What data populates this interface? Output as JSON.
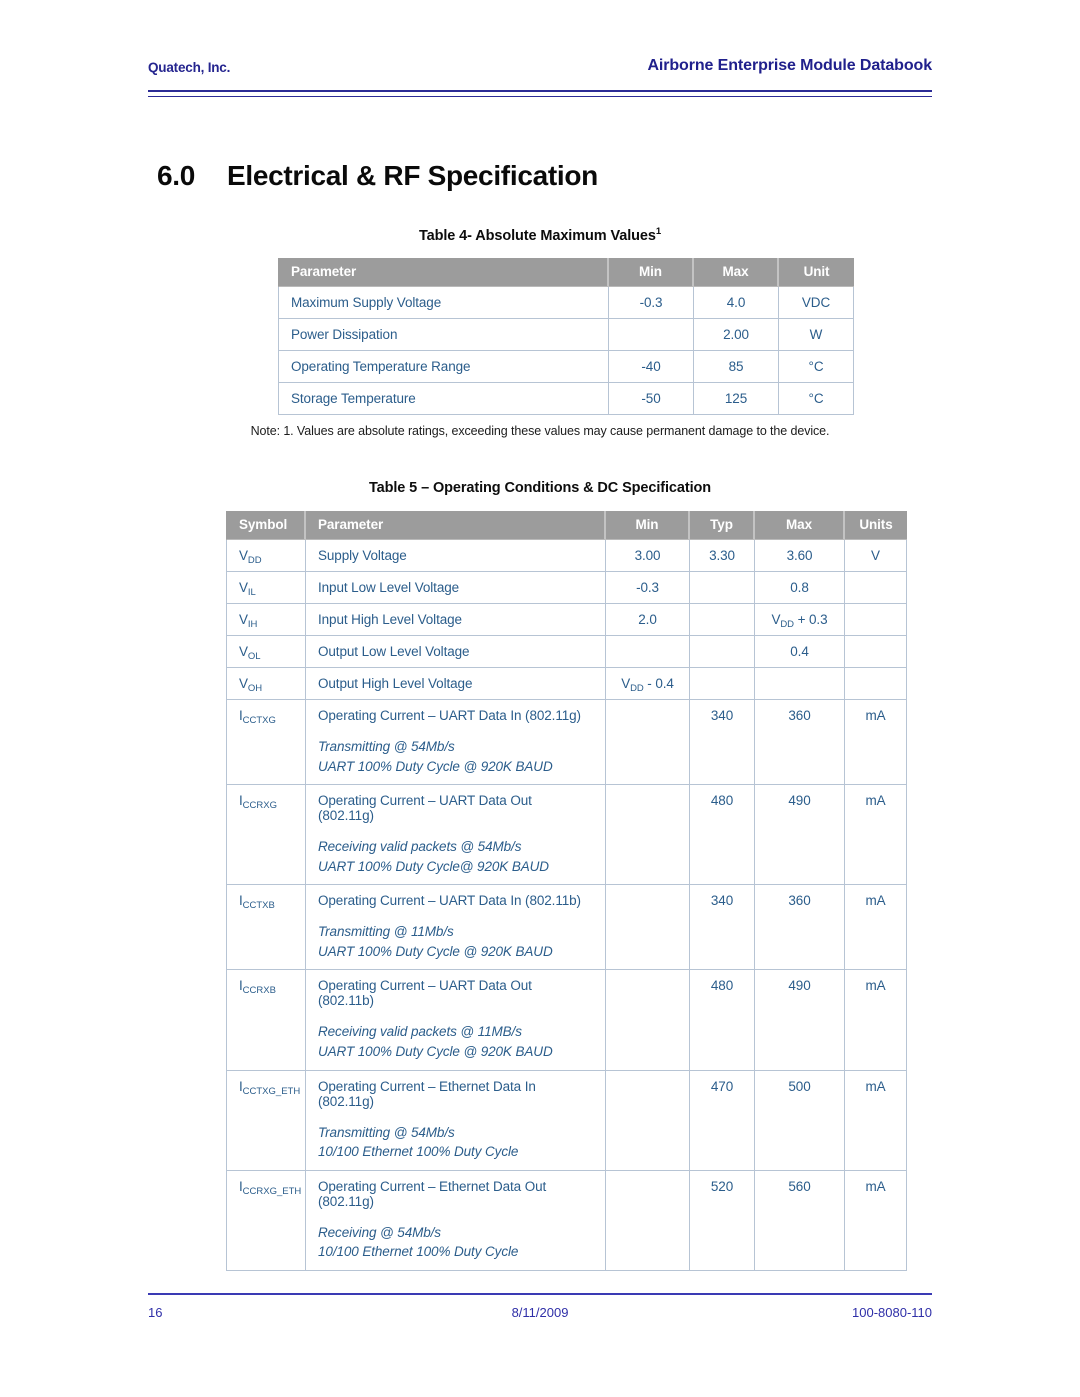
{
  "header": {
    "company": "Quatech, Inc.",
    "document_title": "Airborne Enterprise Module Databook"
  },
  "section": {
    "number": "6.0",
    "title": "Electrical & RF Specification"
  },
  "table4": {
    "caption_text": "Table 4- Absolute Maximum Values",
    "caption_superscript": "1",
    "columns": [
      "Parameter",
      "Min",
      "Max",
      "Unit"
    ],
    "rows": [
      {
        "parameter": "Maximum Supply Voltage",
        "min": "-0.3",
        "max": "4.0",
        "unit": "VDC"
      },
      {
        "parameter": "Power Dissipation",
        "min": "",
        "max": "2.00",
        "unit": "W"
      },
      {
        "parameter": "Operating Temperature Range",
        "min": "-40",
        "max": "85",
        "unit": "°C"
      },
      {
        "parameter": "Storage Temperature",
        "min": "-50",
        "max": "125",
        "unit": "°C"
      }
    ],
    "note": "Note: 1. Values are absolute ratings, exceeding these values may cause permanent damage to the device."
  },
  "table5": {
    "caption": "Table 5 – Operating Conditions & DC Specification",
    "columns": [
      "Symbol",
      "Parameter",
      "Min",
      "Typ",
      "Max",
      "Units"
    ],
    "rows": [
      {
        "symbol_base": "V",
        "symbol_sub": "DD",
        "parameter": "Supply Voltage",
        "parameter_line2": "",
        "italic1": "",
        "italic2": "",
        "min": "3.00",
        "min_sub": "",
        "min_suffix": "",
        "typ": "3.30",
        "max": "3.60",
        "max_sub": "",
        "max_suffix": "",
        "units": "V"
      },
      {
        "symbol_base": "V",
        "symbol_sub": "IL",
        "parameter": "Input Low Level Voltage",
        "parameter_line2": "",
        "italic1": "",
        "italic2": "",
        "min": "-0.3",
        "min_sub": "",
        "min_suffix": "",
        "typ": "",
        "max": "0.8",
        "max_sub": "",
        "max_suffix": "",
        "units": ""
      },
      {
        "symbol_base": "V",
        "symbol_sub": "IH",
        "parameter": "Input High Level Voltage",
        "parameter_line2": "",
        "italic1": "",
        "italic2": "",
        "min": "2.0",
        "min_sub": "",
        "min_suffix": "",
        "typ": "",
        "max": "V",
        "max_sub": "DD",
        "max_suffix": " + 0.3",
        "units": ""
      },
      {
        "symbol_base": "V",
        "symbol_sub": "OL",
        "parameter": "Output Low Level Voltage",
        "parameter_line2": "",
        "italic1": "",
        "italic2": "",
        "min": "",
        "min_sub": "",
        "min_suffix": "",
        "typ": "",
        "max": "0.4",
        "max_sub": "",
        "max_suffix": "",
        "units": ""
      },
      {
        "symbol_base": "V",
        "symbol_sub": "OH",
        "parameter": "Output High Level Voltage",
        "parameter_line2": "",
        "italic1": "",
        "italic2": "",
        "min": "V",
        "min_sub": "DD",
        "min_suffix": " - 0.4",
        "typ": "",
        "max": "",
        "max_sub": "",
        "max_suffix": "",
        "units": ""
      },
      {
        "symbol_base": "I",
        "symbol_sub": "CCTXG",
        "parameter": "Operating Current – UART Data In (802.11g)",
        "parameter_line2": "",
        "italic1": "Transmitting @ 54Mb/s",
        "italic2": "UART 100% Duty Cycle @ 920K BAUD",
        "min": "",
        "min_sub": "",
        "min_suffix": "",
        "typ": "340",
        "max": "360",
        "max_sub": "",
        "max_suffix": "",
        "units": "mA"
      },
      {
        "symbol_base": "I",
        "symbol_sub": "CCRXG",
        "parameter": "Operating Current – UART Data Out",
        "parameter_line2": "(802.11g)",
        "italic1": "Receiving valid packets @ 54Mb/s",
        "italic2": "UART 100% Duty Cycle@ 920K BAUD",
        "min": "",
        "min_sub": "",
        "min_suffix": "",
        "typ": "480",
        "max": "490",
        "max_sub": "",
        "max_suffix": "",
        "units": "mA"
      },
      {
        "symbol_base": "I",
        "symbol_sub": "CCTXB",
        "parameter": "Operating Current – UART Data In (802.11b)",
        "parameter_line2": "",
        "italic1": "Transmitting @ 11Mb/s",
        "italic2": "UART 100% Duty Cycle @ 920K BAUD",
        "min": "",
        "min_sub": "",
        "min_suffix": "",
        "typ": "340",
        "max": "360",
        "max_sub": "",
        "max_suffix": "",
        "units": "mA"
      },
      {
        "symbol_base": "I",
        "symbol_sub": "CCRXB",
        "parameter": "Operating Current – UART Data Out",
        "parameter_line2": "(802.11b)",
        "italic1": "Receiving valid packets @ 11MB/s",
        "italic2": "UART 100% Duty Cycle @ 920K BAUD",
        "min": "",
        "min_sub": "",
        "min_suffix": "",
        "typ": "480",
        "max": "490",
        "max_sub": "",
        "max_suffix": "",
        "units": "mA"
      },
      {
        "symbol_base": "I",
        "symbol_sub": "CCTXG_ETH",
        "parameter": "Operating Current – Ethernet Data In",
        "parameter_line2": "(802.11g)",
        "italic1": "Transmitting @ 54Mb/s",
        "italic2": "10/100 Ethernet 100% Duty Cycle",
        "min": "",
        "min_sub": "",
        "min_suffix": "",
        "typ": "470",
        "max": "500",
        "max_sub": "",
        "max_suffix": "",
        "units": "mA"
      },
      {
        "symbol_base": "I",
        "symbol_sub": "CCRXG_ETH",
        "parameter": "Operating Current – Ethernet Data Out",
        "parameter_line2": "(802.11g)",
        "italic1": "Receiving @ 54Mb/s",
        "italic2": "10/100 Ethernet 100% Duty Cycle",
        "min": "",
        "min_sub": "",
        "min_suffix": "",
        "typ": "520",
        "max": "560",
        "max_sub": "",
        "max_suffix": "",
        "units": "mA"
      }
    ]
  },
  "footer": {
    "page_number": "16",
    "date": "8/11/2009",
    "document_number": "100-8080-110"
  },
  "colors": {
    "header_rule": "#2b2b96",
    "title_blue": "#20208c",
    "table_header_bg": "#9c9c9c",
    "table_text_blue": "#2b5d8b",
    "table_border": "#b7c4d4",
    "footer_blue": "#2f2fa8"
  }
}
